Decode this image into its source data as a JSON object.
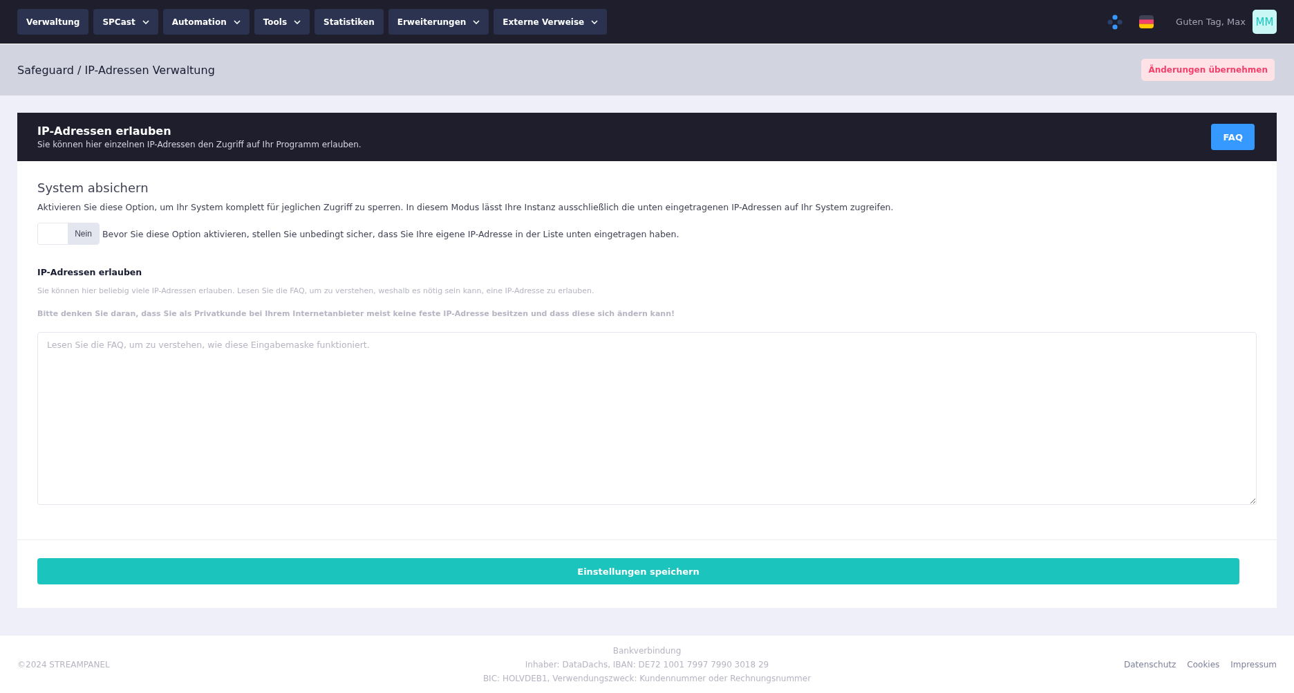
{
  "nav": [
    {
      "label": "Verwaltung",
      "dropdown": false
    },
    {
      "label": "SPCast",
      "dropdown": true
    },
    {
      "label": "Automation",
      "dropdown": true
    },
    {
      "label": "Tools",
      "dropdown": true
    },
    {
      "label": "Statistiken",
      "dropdown": false
    },
    {
      "label": "Erweiterungen",
      "dropdown": true
    },
    {
      "label": "Externe Verweise",
      "dropdown": true
    }
  ],
  "user": {
    "greeting": "Guten Tag, Max",
    "initials": "MM"
  },
  "breadcrumb": "Safeguard / IP-Adressen Verwaltung",
  "apply_button": "Änderungen übernehmen",
  "card": {
    "title": "IP-Adressen erlauben",
    "subtitle": "Sie können hier einzelnen IP-Adressen den Zugriff auf Ihr Programm erlauben.",
    "faq_button": "FAQ",
    "section_title": "System absichern",
    "section_text": "Aktivieren Sie diese Option, um Ihr System komplett für jeglichen Zugriff zu sperren. In diesem Modus lässt Ihre Instanz ausschließlich die unten eingetragenen IP-Adressen auf Ihr System zugreifen.",
    "toggle": {
      "on": false,
      "label": "Nein"
    },
    "toggle_hint": "Bevor Sie diese Option aktivieren, stellen Sie unbedingt sicher, dass Sie Ihre eigene IP-Adresse in der Liste unten eingetragen haben.",
    "field_label": "IP-Adressen erlauben",
    "help_text": "Sie können hier beliebig viele IP-Adressen erlauben. Lesen Sie die FAQ, um zu verstehen, weshalb es nötig sein kann, eine IP-Adresse zu erlauben.",
    "warning_text": "Bitte denken Sie daran, dass Sie als Privatkunde bei Ihrem Internetanbieter meist keine feste IP-Adresse besitzen und dass diese sich ändern kann!",
    "textarea": {
      "placeholder": "Lesen Sie die FAQ, um zu verstehen, wie diese Eingabemaske funktioniert."
    },
    "save_button": "Einstellungen speichern"
  },
  "footer": {
    "copyright": "©2024 STREAMPANEL",
    "bank_lines": [
      "Bankverbindung",
      "Inhaber: DataDachs, IBAN: DE72 1001 7997 7990 3018 29",
      "BIC: HOLVDEB1, Verwendungszweck: Kundennummer oder Rechnungsnummer"
    ],
    "links": [
      "Datenschutz",
      "Cookies",
      "Impressum"
    ]
  }
}
